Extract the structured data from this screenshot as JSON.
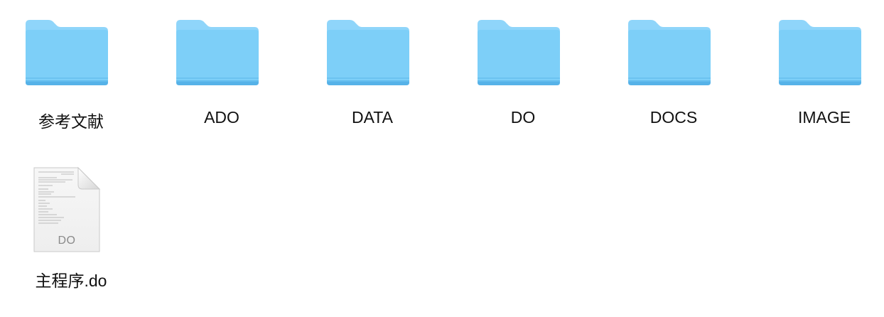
{
  "files": [
    {
      "name": "参考文献",
      "kind": "folder",
      "icon": "folder-icon"
    },
    {
      "name": "ADO",
      "kind": "folder",
      "icon": "folder-icon"
    },
    {
      "name": "DATA",
      "kind": "folder",
      "icon": "folder-icon"
    },
    {
      "name": "DO",
      "kind": "folder",
      "icon": "folder-icon"
    },
    {
      "name": "DOCS",
      "kind": "folder",
      "icon": "folder-icon"
    },
    {
      "name": "IMAGE",
      "kind": "folder",
      "icon": "folder-icon"
    },
    {
      "name": "主程序.do",
      "kind": "document",
      "icon": "do-file-icon",
      "ext_label": "DO"
    }
  ],
  "colors": {
    "folder_body": "#7ccdf7",
    "folder_tab": "#86d1f8",
    "folder_bottom": "#5bb8ec",
    "label_text": "#111111"
  }
}
